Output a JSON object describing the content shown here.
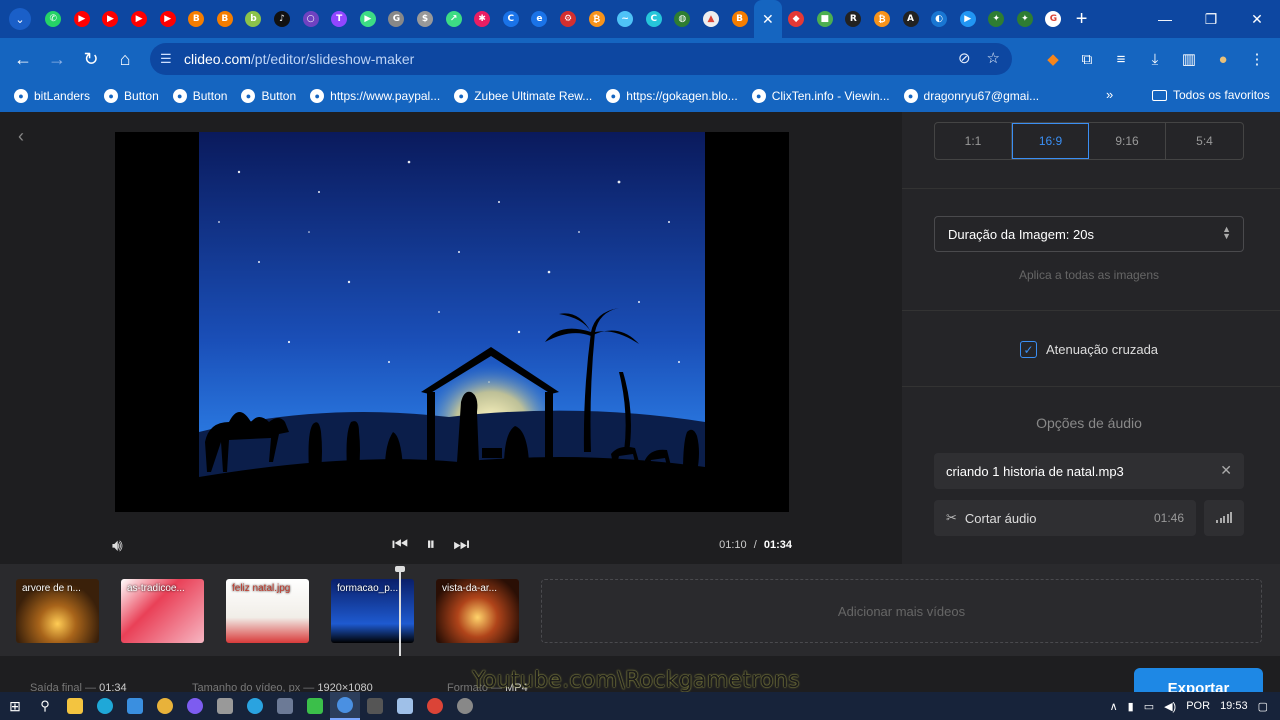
{
  "browser": {
    "tab_favicons": [
      "whatsapp",
      "youtube",
      "youtube",
      "youtube",
      "youtube",
      "blogger",
      "blogger",
      "bitlanders",
      "tiktok",
      "circle",
      "twitch",
      "play",
      "google-g",
      "dollar",
      "arrows",
      "pinwheel",
      "c-logo",
      "e-logo",
      "gear-red",
      "bitcoin",
      "fish",
      "c-teal",
      "globe",
      "shirt",
      "blogger",
      "active-close",
      "multicolor",
      "green-square",
      "r-logo",
      "bitcoin",
      "triangle-a",
      "split-logo",
      "play-blue",
      "bird-green",
      "bird-green",
      "google"
    ],
    "url_domain": "clideo.com",
    "url_path": "/pt/editor/slideshow-maker",
    "bookmarks": [
      {
        "label": "bitLanders"
      },
      {
        "label": "Button"
      },
      {
        "label": "Button"
      },
      {
        "label": "Button"
      },
      {
        "label": "https://www.paypal..."
      },
      {
        "label": "Zubee Ultimate Rew..."
      },
      {
        "label": "https://gokagen.blo..."
      },
      {
        "label": "ClixTen.info - Viewin..."
      },
      {
        "label": "dragonryu67@gmai..."
      }
    ],
    "bookmarks_more": "»",
    "all_bookmarks": "Todos os favoritos"
  },
  "player": {
    "current_time": "01:10",
    "separator": "/",
    "total_time": "01:34"
  },
  "panel": {
    "aspect_ratios": [
      "1:1",
      "16:9",
      "9:16",
      "5:4"
    ],
    "selected_ratio": "16:9",
    "image_duration": "Duração da Imagem: 20s",
    "apply_all": "Aplica a todas as imagens",
    "crossfade_label": "Atenuação cruzada",
    "crossfade_checked": true,
    "audio_title": "Opções de áudio",
    "audio_file": "criando 1 historia de natal.mp3",
    "cut_audio": "Cortar áudio",
    "audio_length": "01:46"
  },
  "timeline": {
    "clips": [
      {
        "label": "arvore de n...",
        "color": "#6b4a1e"
      },
      {
        "label": "as-tradicoe...",
        "color": "#d83a4a"
      },
      {
        "label": "feliz natal.jpg",
        "color": "#f2efe9"
      },
      {
        "label": "formacao_p...",
        "color": "#0a2a7a"
      },
      {
        "label": "vista-da-ar...",
        "color": "#5a2a10"
      }
    ],
    "add_more": "Adicionar mais vídeos"
  },
  "footer": {
    "output_label": "Saída final —",
    "output_value": "01:34",
    "size_label": "Tamanho do vídeo, px —",
    "size_value": "1920×1080",
    "format_label": "Formato —",
    "format_value": "MP4",
    "export": "Exportar"
  },
  "watermark": "Youtube.com\\Rockgametrons",
  "taskbar": {
    "language": "POR",
    "clock": "19:53"
  }
}
